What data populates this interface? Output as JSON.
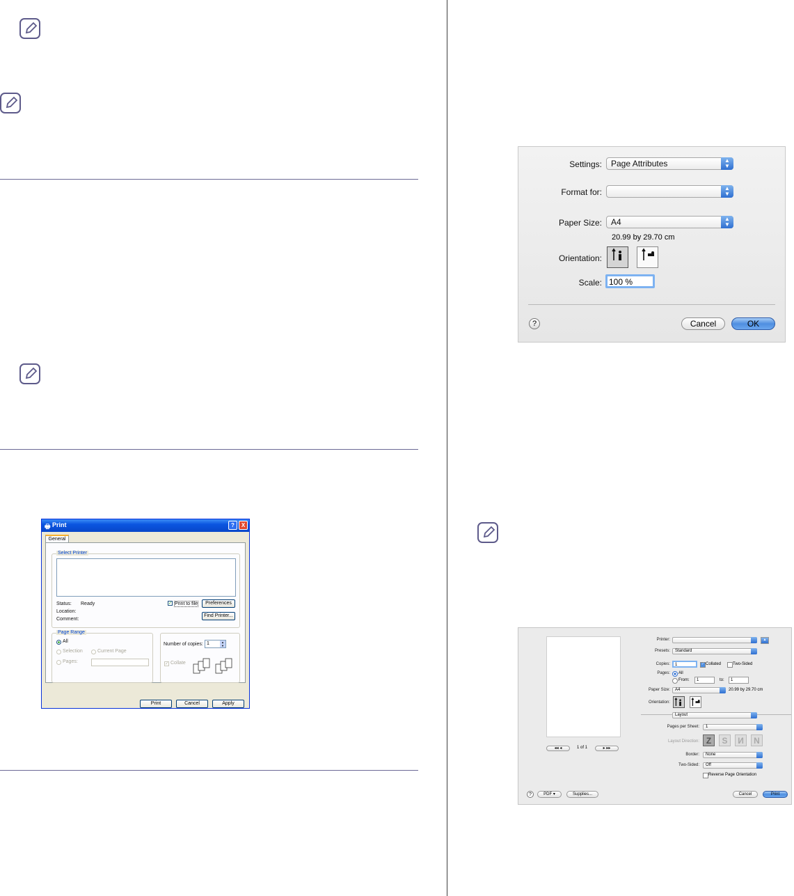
{
  "page_setup_dialog": {
    "settings_label": "Settings:",
    "settings_value": "Page Attributes",
    "format_for_label": "Format for:",
    "format_for_value": "",
    "paper_size_label": "Paper Size:",
    "paper_size_value": "A4",
    "paper_dimensions": "20.99 by 29.70 cm",
    "orientation_label": "Orientation:",
    "scale_label": "Scale:",
    "scale_value": "100 %",
    "help_label": "?",
    "cancel_label": "Cancel",
    "ok_label": "OK"
  },
  "windows_print_dialog": {
    "title": "Print",
    "tab_general": "General",
    "select_printer_title": "Select Printer",
    "status_label": "Status:",
    "status_value": "Ready",
    "location_label": "Location:",
    "comment_label": "Comment:",
    "print_to_file_label": "Print to file",
    "preferences_label": "Preferences",
    "find_printer_label": "Find Printer...",
    "page_range_title": "Page Range",
    "all_label": "All",
    "selection_label": "Selection",
    "current_page_label": "Current Page",
    "pages_label": "Pages:",
    "copies_label": "Number of copies:",
    "copies_value": "1",
    "collate_label": "Collate",
    "print_button": "Print",
    "cancel_button": "Cancel",
    "apply_button": "Apply",
    "help_button": "?",
    "close_button": "X"
  },
  "mac_print_dialog": {
    "printer_label": "Printer:",
    "printer_value": "",
    "presets_label": "Presets:",
    "presets_value": "Standard",
    "copies_label": "Copies:",
    "copies_value": "1",
    "collated_label": "Collated",
    "two_sided_check_label": "Two-Sided",
    "pages_label": "Pages:",
    "all_label": "All",
    "from_label": "From:",
    "from_value": "1",
    "to_label": "to:",
    "to_value": "1",
    "paper_size_label": "Paper Size:",
    "paper_size_value": "A4",
    "paper_dimensions": "20.99 by 29.70 cm",
    "orientation_label": "Orientation:",
    "section_value": "Layout",
    "pages_per_sheet_label": "Pages per Sheet:",
    "pages_per_sheet_value": "1",
    "layout_direction_label": "Layout Direction:",
    "border_label": "Border:",
    "border_value": "None",
    "two_sided_label": "Two-Sided:",
    "two_sided_value": "Off",
    "reverse_orientation_label": "Reverse Page Orientation",
    "page_count": "1 of 1",
    "help_label": "?",
    "pdf_label": "PDF ▾",
    "supplies_label": "Supplies...",
    "cancel_label": "Cancel",
    "print_label": "Print"
  }
}
